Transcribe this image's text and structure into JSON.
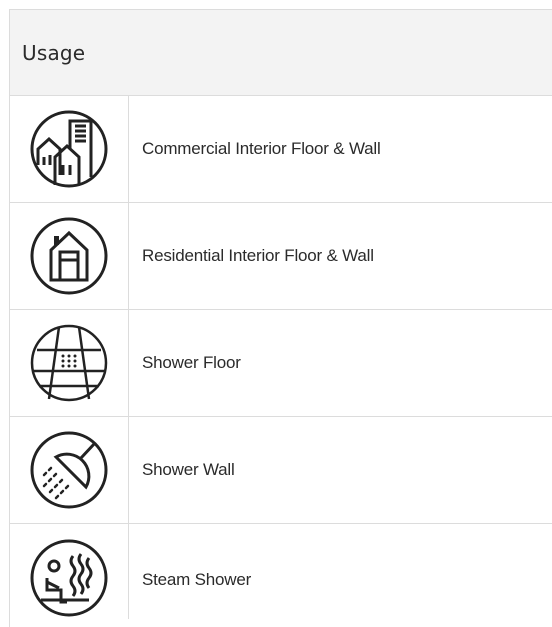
{
  "table": {
    "header": "Usage",
    "rows": [
      {
        "icon": "commercial-buildings-icon",
        "label": "Commercial Interior Floor & Wall"
      },
      {
        "icon": "residential-house-icon",
        "label": "Residential Interior Floor & Wall"
      },
      {
        "icon": "shower-floor-icon",
        "label": "Shower Floor"
      },
      {
        "icon": "shower-head-icon",
        "label": "Shower Wall"
      },
      {
        "icon": "steam-shower-icon",
        "label": "Steam Shower"
      }
    ]
  }
}
